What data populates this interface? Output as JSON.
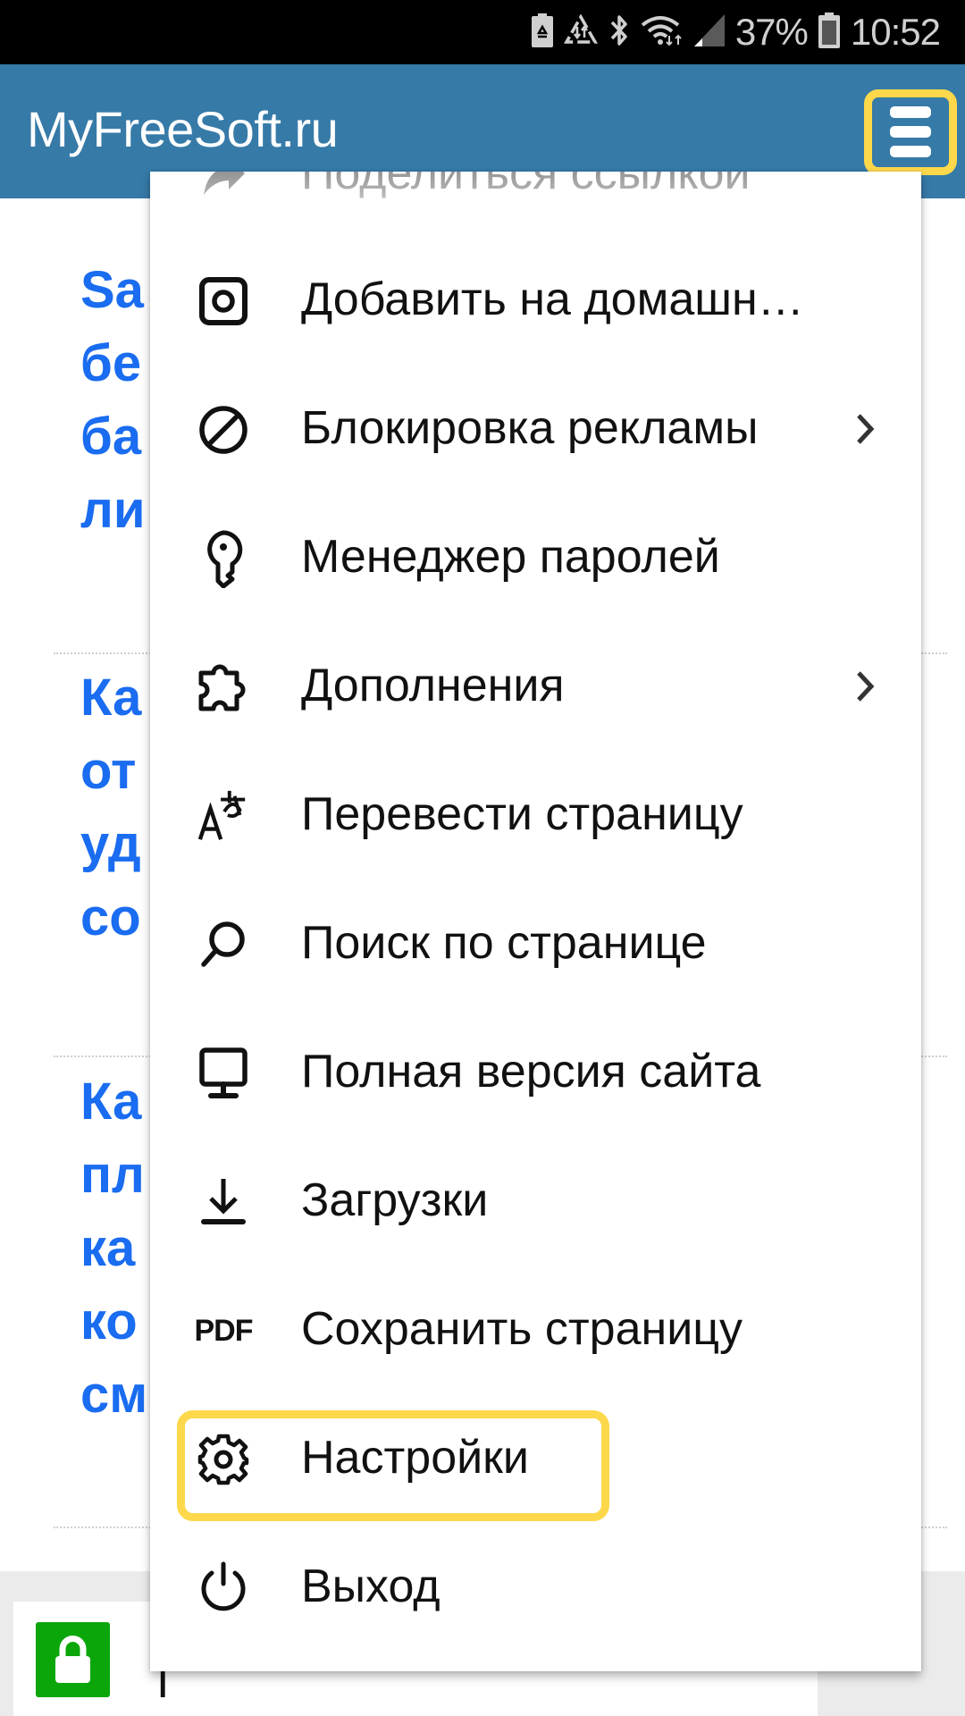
{
  "status_bar": {
    "icons": [
      "battery-saver-icon",
      "data-saver-icon",
      "bluetooth-icon",
      "wifi-icon",
      "signal-icon"
    ],
    "battery_percent": "37%",
    "battery_icon": "battery-icon",
    "time": "10:52"
  },
  "header": {
    "site_title": "MyFreeSoft.ru",
    "menu_button_icon": "hamburger-icon",
    "highlight_color": "#fdd84a",
    "background_color": "#367aa8"
  },
  "page": {
    "articles": [
      {
        "lines": [
          "Sa",
          "бе",
          "ба",
          "ли"
        ]
      },
      {
        "lines": [
          "Ка",
          "от",
          "уд",
          "со"
        ]
      },
      {
        "lines": [
          "Ка",
          "пл",
          "ка",
          "ко",
          "см"
        ]
      }
    ],
    "link_color": "#1a6cf0",
    "bottom_bar": {
      "lock_icon": "lock-icon",
      "lock_color": "#0aa60a",
      "text": "I"
    }
  },
  "menu": {
    "items": [
      {
        "label": "Поделиться ссылкой",
        "icon": "share-icon",
        "has_submenu": false
      },
      {
        "label": "Добавить на домашн…",
        "icon": "add-to-home-icon",
        "has_submenu": false
      },
      {
        "label": "Блокировка рекламы",
        "icon": "block-icon",
        "has_submenu": true
      },
      {
        "label": "Менеджер паролей",
        "icon": "key-icon",
        "has_submenu": false
      },
      {
        "label": "Дополнения",
        "icon": "puzzle-icon",
        "has_submenu": true
      },
      {
        "label": "Перевести страницу",
        "icon": "translate-icon",
        "has_submenu": false
      },
      {
        "label": "Поиск по странице",
        "icon": "search-icon",
        "has_submenu": false
      },
      {
        "label": "Полная версия сайта",
        "icon": "desktop-icon",
        "has_submenu": false
      },
      {
        "label": "Загрузки",
        "icon": "download-icon",
        "has_submenu": false
      },
      {
        "label": "Сохранить страницу",
        "icon": "pdf-icon",
        "icon_text": "PDF",
        "has_submenu": false
      },
      {
        "label": "Настройки",
        "icon": "gear-icon",
        "has_submenu": false,
        "highlighted": true
      },
      {
        "label": "Выход",
        "icon": "power-icon",
        "has_submenu": false
      }
    ]
  }
}
